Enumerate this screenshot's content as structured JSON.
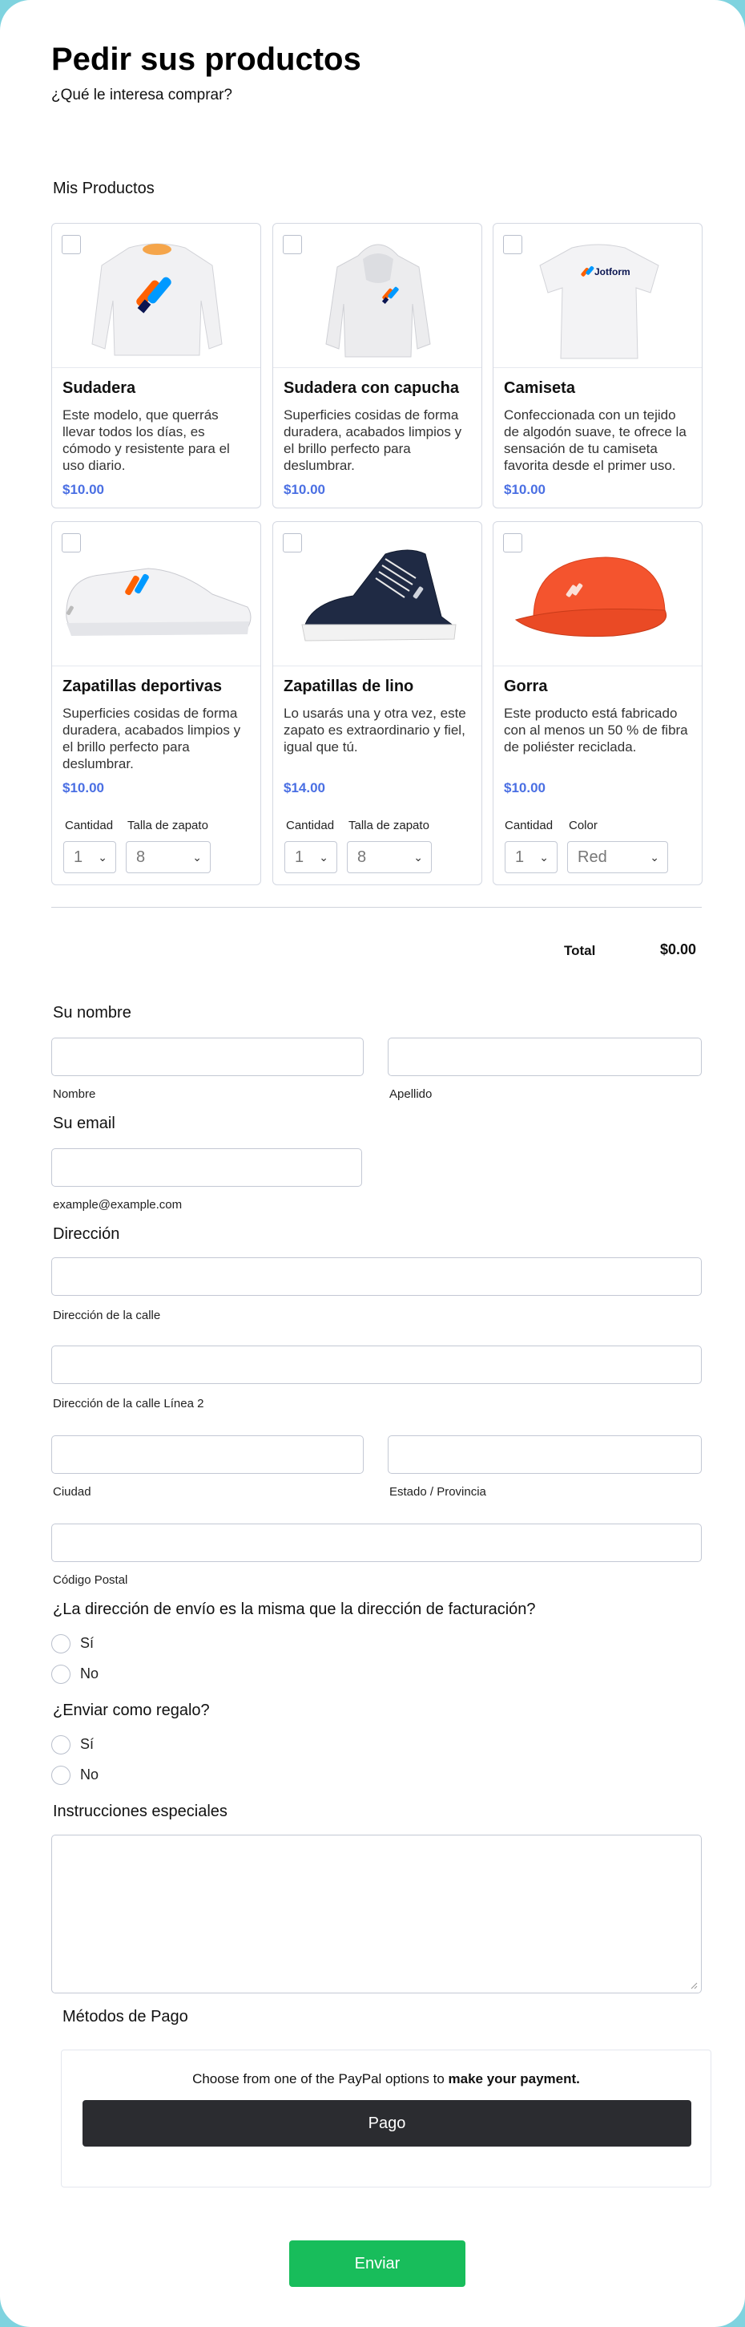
{
  "header": {
    "title": "Pedir sus productos",
    "subtitle": "¿Qué le interesa comprar?"
  },
  "products_label": "Mis Productos",
  "products": [
    {
      "name": "Sudadera",
      "desc": "Este modelo, que querrás llevar todos los días, es cómodo y resistente para el uso diario.",
      "price": "$10.00"
    },
    {
      "name": "Sudadera con capucha",
      "desc": "Superficies cosidas de forma duradera, acabados limpios y el brillo perfecto para deslumbrar.",
      "price": "$10.00"
    },
    {
      "name": "Camiseta",
      "desc": "Confeccionada con un tejido de algodón suave, te ofrece la sensación de tu camiseta favorita desde el primer uso.",
      "price": "$10.00"
    },
    {
      "name": "Zapatillas deportivas",
      "desc": "Superficies cosidas de forma duradera, acabados limpios y el brillo perfecto para deslumbrar.",
      "price": "$10.00",
      "qty_label": "Cantidad",
      "qty": "1",
      "opt_label": "Talla de zapato",
      "opt": "8"
    },
    {
      "name": "Zapatillas de lino",
      "desc": "Lo usarás una y otra vez, este zapato es extraordinario y fiel, igual que tú.",
      "price": "$14.00",
      "qty_label": "Cantidad",
      "qty": "1",
      "opt_label": "Talla de zapato",
      "opt": "8"
    },
    {
      "name": "Gorra",
      "desc": "Este producto está fabricado con al menos un 50 % de fibra de poliéster reciclada.",
      "price": "$10.00",
      "qty_label": "Cantidad",
      "qty": "1",
      "opt_label": "Color",
      "opt": "Red"
    }
  ],
  "tshirt_logo_text": "Jotform",
  "total": {
    "label": "Total",
    "value": "$0.00"
  },
  "name_section": {
    "label": "Su nombre",
    "first": "Nombre",
    "last": "Apellido"
  },
  "email_section": {
    "label": "Su email",
    "hint": "example@example.com"
  },
  "address": {
    "label": "Dirección",
    "street1": "Dirección de la calle",
    "street2": "Dirección de la calle Línea 2",
    "city": "Ciudad",
    "state": "Estado / Provincia",
    "zip": "Código Postal"
  },
  "shipping_same": {
    "question": "¿La dirección de envío es la misma que la dirección de facturación?",
    "yes": "Sí",
    "no": "No"
  },
  "gift": {
    "question": "¿Enviar como regalo?",
    "yes": "Sí",
    "no": "No"
  },
  "instructions_label": "Instrucciones especiales",
  "payment": {
    "label": "Métodos de Pago",
    "line_prefix": "Choose from one of the PayPal options to ",
    "line_bold": "make your payment.",
    "button": "Pago"
  },
  "submit": "Enviar",
  "colors": {
    "accent_price": "#4a6fe3",
    "submit_bg": "#18bd5b",
    "pay_bg": "#2b2c30",
    "background": "#7fd3df"
  }
}
